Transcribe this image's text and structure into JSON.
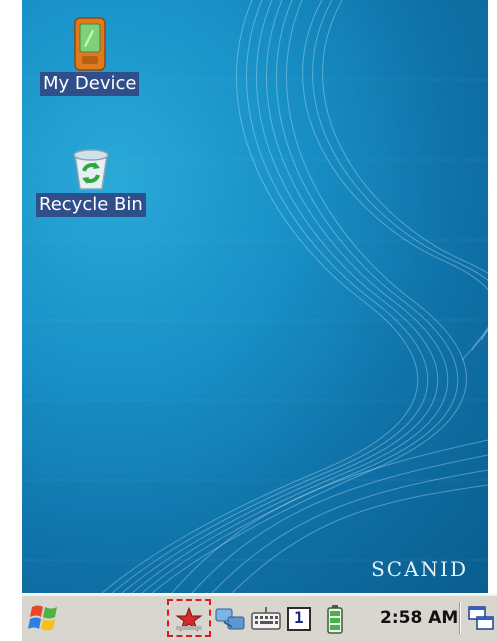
{
  "desktop": {
    "icons": [
      {
        "label": "My Device",
        "icon": "device-icon"
      },
      {
        "label": "Recycle Bin",
        "icon": "recycle-bin-icon"
      }
    ],
    "brand": "SCANID",
    "background": "#1890c6"
  },
  "taskbar": {
    "start_icon": "windows-flag-icon",
    "tray": [
      "bluetooth-star-icon",
      "network-connection-icon",
      "keyboard-icon",
      "input-mode-icon",
      "battery-icon"
    ],
    "input_mode": "1",
    "clock": "2:58 AM",
    "desktop_toggle_icon": "switch-windows-icon"
  },
  "colors": {
    "taskbar": "#d9d6cf",
    "highlight": "#e01919",
    "label_bg": "#2f4f8a"
  }
}
